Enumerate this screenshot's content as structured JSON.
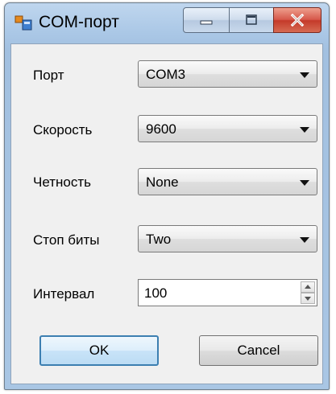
{
  "window": {
    "title": "COM-порт",
    "icon": "application-window-icon",
    "caption_buttons": [
      "minimize-icon",
      "maximize-icon",
      "close-icon"
    ]
  },
  "form": {
    "port": {
      "label": "Порт",
      "value": "COM3"
    },
    "baud": {
      "label": "Скорость",
      "value": "9600"
    },
    "parity": {
      "label": "Четность",
      "value": "None"
    },
    "stop_bits": {
      "label": "Стоп биты",
      "value": "Two"
    },
    "interval": {
      "label": "Интервал",
      "value": "100"
    }
  },
  "buttons": {
    "ok": "OK",
    "cancel": "Cancel"
  },
  "colors": {
    "close_button": "#c43a2a",
    "ok_focus_border": "#3c7fb1",
    "client_background": "#f0f0f0"
  }
}
